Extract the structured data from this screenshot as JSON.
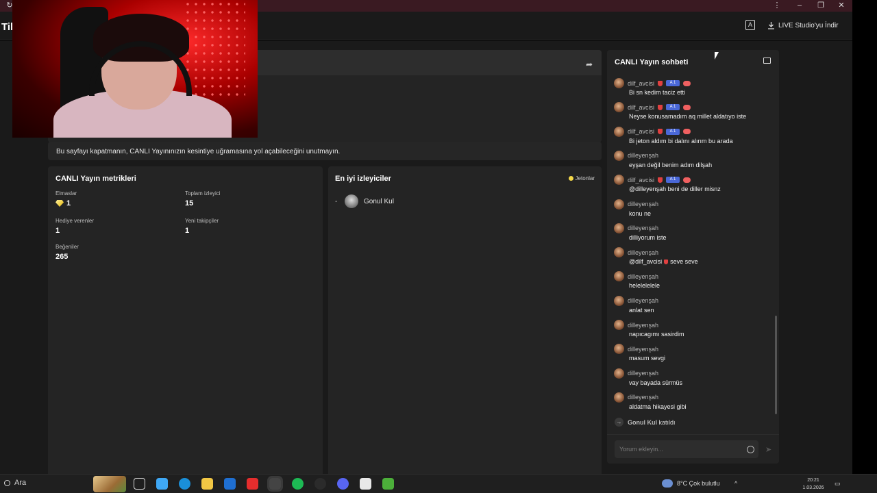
{
  "window": {
    "app_title": "Til",
    "studio_label": "A",
    "download_label": "LIVE Studio'yu İndir",
    "minimize": "–",
    "maximize": "❐",
    "close": "✕",
    "menu": "⋮",
    "refresh": "↻"
  },
  "notice": "Bu sayfayı kapatmanın, CANLI Yayınınızın kesintiye uğramasına yol açabileceğini unutmayın.",
  "metrics": {
    "title": "CANLI Yayın metrikleri",
    "items": [
      {
        "label": "Elmaslar",
        "value": "1",
        "icon": "diamond-icon"
      },
      {
        "label": "Toplam izleyici",
        "value": "15"
      },
      {
        "label": "Hediye verenler",
        "value": "1"
      },
      {
        "label": "Yeni takipçiler",
        "value": "1"
      },
      {
        "label": "Beğeniler",
        "value": "265"
      }
    ]
  },
  "top_viewers": {
    "title": "En iyi izleyiciler",
    "sort_label": "Jetonlar",
    "rows": [
      {
        "rank": "-",
        "name": "Gonul Kul"
      }
    ]
  },
  "chat": {
    "title": "CANLI Yayın sohbeti",
    "messages": [
      {
        "user": "dilf_avcisi",
        "badges": true,
        "badge_level": "A 1",
        "text": "Bi sn kedim taciz etti"
      },
      {
        "user": "dilf_avcisi",
        "badges": true,
        "badge_level": "A 1",
        "text": "Neyse konusamadım aq millet aldatıyo iste"
      },
      {
        "user": "dilf_avcisi",
        "badges": true,
        "badge_level": "A 1",
        "text": "Bi jeton aldım bi dalını alırım bu arada"
      },
      {
        "user": "dilleyenşah",
        "badges": false,
        "text": "eyşan değil benim adım dilşah"
      },
      {
        "user": "dilf_avcisi",
        "badges": true,
        "badge_level": "A 1",
        "text": "@dilleyenşah beni de diller misnz"
      },
      {
        "user": "dilleyenşah",
        "badges": false,
        "text": "konu ne"
      },
      {
        "user": "dilleyenşah",
        "badges": false,
        "text": "dilliyorum iste"
      },
      {
        "user": "dilleyenşah",
        "badges": false,
        "text_pre": "@dilf_avcisi",
        "text": "seve seve",
        "mention_badge": true
      },
      {
        "user": "dilleyenşah",
        "badges": false,
        "text": "helelelelele"
      },
      {
        "user": "dilleyenşah",
        "badges": false,
        "text": "anlat sen"
      },
      {
        "user": "dilleyenşah",
        "badges": false,
        "text": "napıcagımı sasirdim"
      },
      {
        "user": "dilleyenşah",
        "badges": false,
        "text": "masum sevgi"
      },
      {
        "user": "dilleyenşah",
        "badges": false,
        "text": "vay bayada sürmüs"
      },
      {
        "user": "dilleyenşah",
        "badges": false,
        "text": "aldatma hikayesi gibi"
      }
    ],
    "joined": {
      "user": "Gonul Kul",
      "action": "katıldı"
    },
    "input_placeholder": "Yorum ekleyin..."
  },
  "taskbar": {
    "search_label": "Ara",
    "weather": "8°C  Çok bulutlu",
    "time": "20:21",
    "date": "1.03.2026",
    "tray_arrow": "^",
    "icons": [
      "task-view-icon",
      "copilot-icon",
      "edge-icon",
      "file-explorer-icon",
      "outlook-icon",
      "youtube-icon",
      "tiktok-live-studio-icon",
      "spotify-icon",
      "screen-recorder-icon",
      "discord-icon",
      "microsoft-store-icon",
      "minecraft-icon"
    ],
    "colors": {
      "copilot": "#3fa8f5",
      "edge": "#1a8fd8",
      "explorer": "#f2c744",
      "outlook": "#1f6fd1",
      "youtube": "#e52d2d",
      "tiktok": "#333333",
      "spotify": "#1db954",
      "recorder": "#2b2b2b",
      "discord": "#5865f2",
      "store": "#e8e8e8",
      "minecraft": "#4caf3a"
    }
  }
}
